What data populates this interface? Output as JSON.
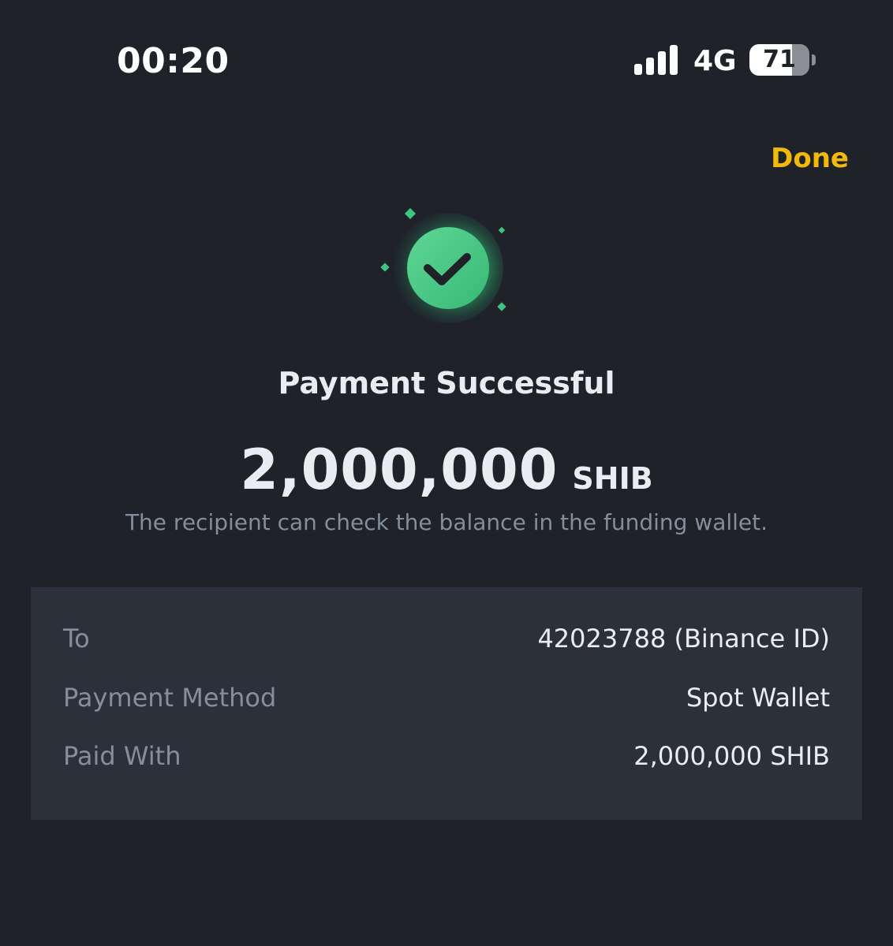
{
  "status_bar": {
    "time": "00:20",
    "network": "4G",
    "battery_level": "71",
    "battery_fraction": 0.71
  },
  "header": {
    "done_label": "Done"
  },
  "result": {
    "title": "Payment Successful",
    "amount": "2,000,000",
    "unit": "SHIB",
    "note": "The recipient can check the balance in the funding wallet."
  },
  "details": [
    {
      "label": "To",
      "value": "42023788 (Binance ID)"
    },
    {
      "label": "Payment Method",
      "value": "Spot Wallet"
    },
    {
      "label": "Paid With",
      "value": "2,000,000 SHIB"
    }
  ],
  "colors": {
    "background": "#1f2229",
    "card": "#2b303b",
    "accent": "#f0b90b",
    "success": "#3ec482",
    "text_primary": "#eaecef",
    "text_secondary": "#848e9c"
  },
  "icons": {
    "signal": "signal-bars-icon",
    "battery": "battery-icon",
    "success": "check-circle-icon"
  }
}
